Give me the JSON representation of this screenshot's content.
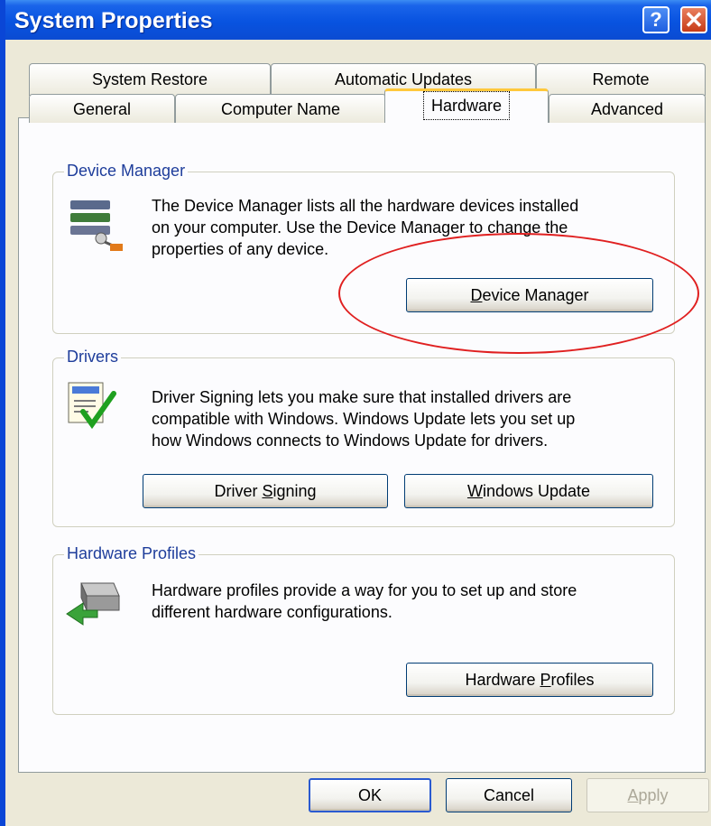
{
  "window": {
    "title": "System Properties",
    "help_glyph": "?",
    "close_glyph": "✕"
  },
  "tabs_back": [
    "System Restore",
    "Automatic Updates",
    "Remote"
  ],
  "tabs_front": [
    "General",
    "Computer Name",
    "Hardware",
    "Advanced"
  ],
  "active_tab": "Hardware",
  "device_manager": {
    "title": "Device Manager",
    "description": [
      "The Device Manager lists all the hardware devices installed",
      "on your computer. Use the Device Manager to change the",
      "properties of any device."
    ],
    "button": {
      "pre": "",
      "mnemonic": "D",
      "post": "evice Manager"
    },
    "icon": "device-manager-icon"
  },
  "drivers": {
    "title": "Drivers",
    "description": [
      "Driver Signing lets you make sure that installed drivers are",
      "compatible with Windows. Windows Update lets you set up",
      "how Windows connects to Windows Update for drivers."
    ],
    "signing_button": {
      "pre": "Driver ",
      "mnemonic": "S",
      "post": "igning"
    },
    "update_button": {
      "pre": "",
      "mnemonic": "W",
      "post": "indows Update"
    },
    "icon": "driver-signing-icon"
  },
  "hardware_profiles": {
    "title": "Hardware Profiles",
    "description": [
      "Hardware profiles provide a way for you to set up and store",
      "different hardware configurations."
    ],
    "button": {
      "pre": "Hardware ",
      "mnemonic": "P",
      "post": "rofiles"
    },
    "icon": "hardware-profiles-icon"
  },
  "footer": {
    "ok": "OK",
    "cancel": "Cancel",
    "apply": {
      "pre": "",
      "mnemonic": "A",
      "post": "pply"
    }
  },
  "colors": {
    "titlebar": "#0853e0",
    "highlight": "#e02020",
    "group_title": "#1e3d9b"
  }
}
